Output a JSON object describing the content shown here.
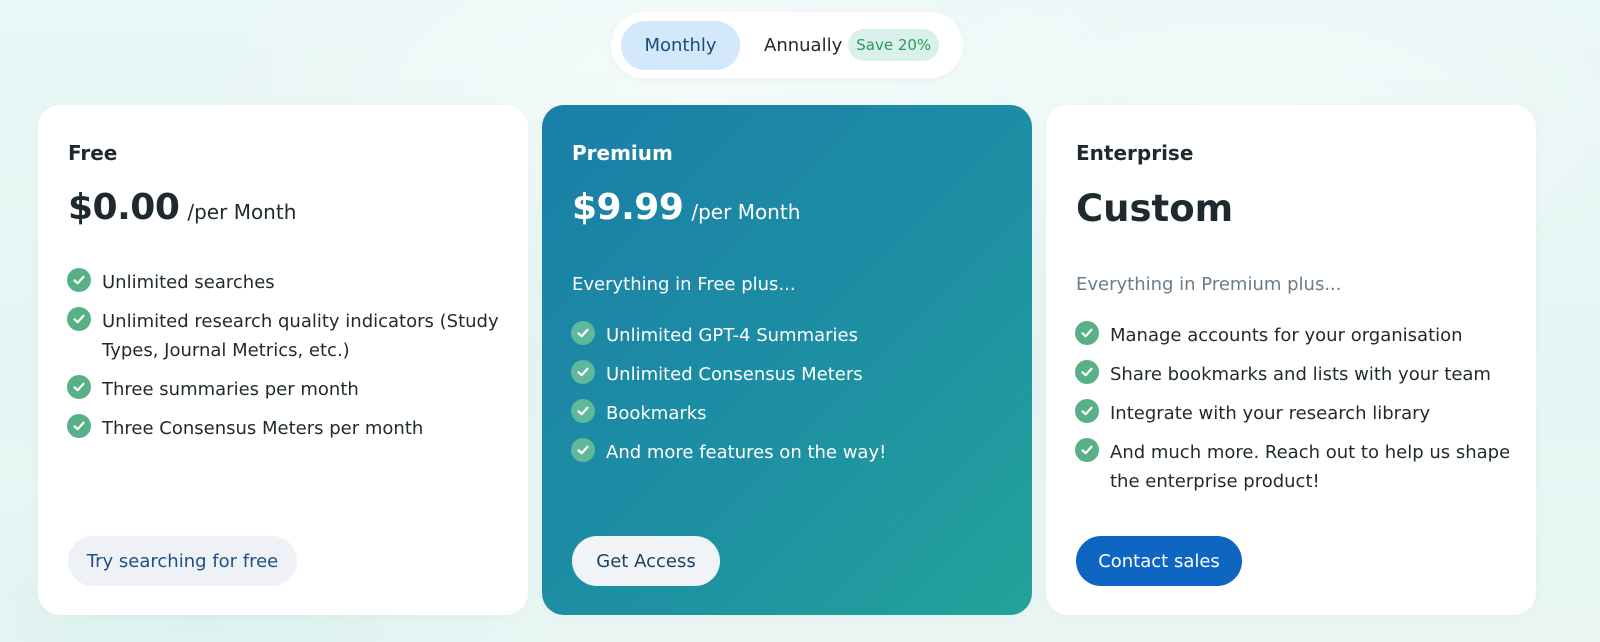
{
  "billing_toggle": {
    "monthly_label": "Monthly",
    "annually_label": "Annually",
    "save_badge": "Save 20%"
  },
  "plans": [
    {
      "name": "Free",
      "price": "$0.00",
      "period": "/per Month",
      "features": [
        "Unlimited searches",
        "Unlimited research quality indicators (Study Types, Journal Metrics, etc.)",
        "Three summaries per month",
        "Three Consensus Meters per month"
      ],
      "cta": "Try searching for free"
    },
    {
      "name": "Premium",
      "price": "$9.99",
      "period": "/per Month",
      "intro": "Everything in Free plus...",
      "features": [
        "Unlimited GPT-4 Summaries",
        "Unlimited Consensus Meters",
        "Bookmarks",
        "And more features on the way!"
      ],
      "cta": "Get Access"
    },
    {
      "name": "Enterprise",
      "price": "Custom",
      "intro": "Everything in Premium plus...",
      "features": [
        "Manage accounts for your organisation",
        "Share bookmarks and lists with your team",
        "Integrate with your research library",
        "And much more. Reach out to help us shape the enterprise product!"
      ],
      "cta": "Contact sales"
    }
  ],
  "colors": {
    "check": "#58b087",
    "premium_gradient_start": "#1a7fa8",
    "premium_gradient_end": "#23a39a",
    "contact_button": "#0f66c2",
    "toggle_active": "#d3e8fb"
  }
}
